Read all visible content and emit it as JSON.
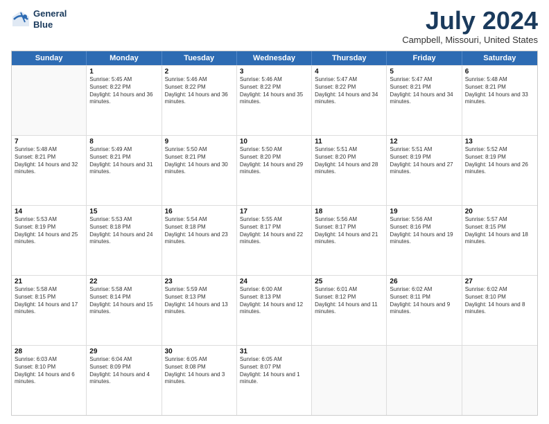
{
  "logo": {
    "line1": "General",
    "line2": "Blue"
  },
  "title": "July 2024",
  "location": "Campbell, Missouri, United States",
  "days_of_week": [
    "Sunday",
    "Monday",
    "Tuesday",
    "Wednesday",
    "Thursday",
    "Friday",
    "Saturday"
  ],
  "weeks": [
    [
      {
        "day": "",
        "empty": true
      },
      {
        "day": "1",
        "sunrise": "5:45 AM",
        "sunset": "8:22 PM",
        "daylight": "14 hours and 36 minutes."
      },
      {
        "day": "2",
        "sunrise": "5:46 AM",
        "sunset": "8:22 PM",
        "daylight": "14 hours and 36 minutes."
      },
      {
        "day": "3",
        "sunrise": "5:46 AM",
        "sunset": "8:22 PM",
        "daylight": "14 hours and 35 minutes."
      },
      {
        "day": "4",
        "sunrise": "5:47 AM",
        "sunset": "8:22 PM",
        "daylight": "14 hours and 34 minutes."
      },
      {
        "day": "5",
        "sunrise": "5:47 AM",
        "sunset": "8:21 PM",
        "daylight": "14 hours and 34 minutes."
      },
      {
        "day": "6",
        "sunrise": "5:48 AM",
        "sunset": "8:21 PM",
        "daylight": "14 hours and 33 minutes."
      }
    ],
    [
      {
        "day": "7",
        "sunrise": "5:48 AM",
        "sunset": "8:21 PM",
        "daylight": "14 hours and 32 minutes."
      },
      {
        "day": "8",
        "sunrise": "5:49 AM",
        "sunset": "8:21 PM",
        "daylight": "14 hours and 31 minutes."
      },
      {
        "day": "9",
        "sunrise": "5:50 AM",
        "sunset": "8:21 PM",
        "daylight": "14 hours and 30 minutes."
      },
      {
        "day": "10",
        "sunrise": "5:50 AM",
        "sunset": "8:20 PM",
        "daylight": "14 hours and 29 minutes."
      },
      {
        "day": "11",
        "sunrise": "5:51 AM",
        "sunset": "8:20 PM",
        "daylight": "14 hours and 28 minutes."
      },
      {
        "day": "12",
        "sunrise": "5:51 AM",
        "sunset": "8:19 PM",
        "daylight": "14 hours and 27 minutes."
      },
      {
        "day": "13",
        "sunrise": "5:52 AM",
        "sunset": "8:19 PM",
        "daylight": "14 hours and 26 minutes."
      }
    ],
    [
      {
        "day": "14",
        "sunrise": "5:53 AM",
        "sunset": "8:19 PM",
        "daylight": "14 hours and 25 minutes."
      },
      {
        "day": "15",
        "sunrise": "5:53 AM",
        "sunset": "8:18 PM",
        "daylight": "14 hours and 24 minutes."
      },
      {
        "day": "16",
        "sunrise": "5:54 AM",
        "sunset": "8:18 PM",
        "daylight": "14 hours and 23 minutes."
      },
      {
        "day": "17",
        "sunrise": "5:55 AM",
        "sunset": "8:17 PM",
        "daylight": "14 hours and 22 minutes."
      },
      {
        "day": "18",
        "sunrise": "5:56 AM",
        "sunset": "8:17 PM",
        "daylight": "14 hours and 21 minutes."
      },
      {
        "day": "19",
        "sunrise": "5:56 AM",
        "sunset": "8:16 PM",
        "daylight": "14 hours and 19 minutes."
      },
      {
        "day": "20",
        "sunrise": "5:57 AM",
        "sunset": "8:15 PM",
        "daylight": "14 hours and 18 minutes."
      }
    ],
    [
      {
        "day": "21",
        "sunrise": "5:58 AM",
        "sunset": "8:15 PM",
        "daylight": "14 hours and 17 minutes."
      },
      {
        "day": "22",
        "sunrise": "5:58 AM",
        "sunset": "8:14 PM",
        "daylight": "14 hours and 15 minutes."
      },
      {
        "day": "23",
        "sunrise": "5:59 AM",
        "sunset": "8:13 PM",
        "daylight": "14 hours and 13 minutes."
      },
      {
        "day": "24",
        "sunrise": "6:00 AM",
        "sunset": "8:13 PM",
        "daylight": "14 hours and 12 minutes."
      },
      {
        "day": "25",
        "sunrise": "6:01 AM",
        "sunset": "8:12 PM",
        "daylight": "14 hours and 11 minutes."
      },
      {
        "day": "26",
        "sunrise": "6:02 AM",
        "sunset": "8:11 PM",
        "daylight": "14 hours and 9 minutes."
      },
      {
        "day": "27",
        "sunrise": "6:02 AM",
        "sunset": "8:10 PM",
        "daylight": "14 hours and 8 minutes."
      }
    ],
    [
      {
        "day": "28",
        "sunrise": "6:03 AM",
        "sunset": "8:10 PM",
        "daylight": "14 hours and 6 minutes."
      },
      {
        "day": "29",
        "sunrise": "6:04 AM",
        "sunset": "8:09 PM",
        "daylight": "14 hours and 4 minutes."
      },
      {
        "day": "30",
        "sunrise": "6:05 AM",
        "sunset": "8:08 PM",
        "daylight": "14 hours and 3 minutes."
      },
      {
        "day": "31",
        "sunrise": "6:05 AM",
        "sunset": "8:07 PM",
        "daylight": "14 hours and 1 minute."
      },
      {
        "day": "",
        "empty": true
      },
      {
        "day": "",
        "empty": true
      },
      {
        "day": "",
        "empty": true
      }
    ]
  ]
}
